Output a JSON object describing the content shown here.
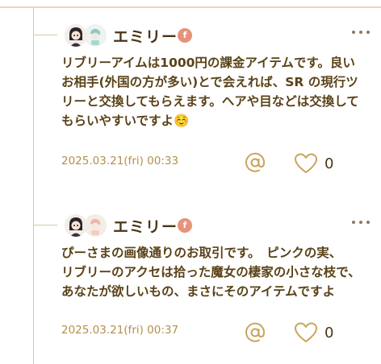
{
  "comments": [
    {
      "username": "エミリー",
      "badge": "f",
      "body": "リブリーアイムは1000円の課金アイテムです。良い\nお相手(外国の方が多い)とで会えれば、SR の現行ツ\nリーと交換してもらえます。ヘアや目などは交換して\nもらいやすいですよ☺️",
      "timestamp": "2025.03.21(fri) 00:33",
      "like_count": "0"
    },
    {
      "username": "エミリー",
      "badge": "f",
      "body": "ぴーさまの画像通りのお取引です。　ピンクの実、\nリブリーのアクセは拾った魔女の棲家の小さな枝で、\nあなたが欲しいもの、まさにそのアイテムですよ",
      "timestamp": "2025.03.21(fri) 00:37",
      "like_count": "0"
    }
  ],
  "icons": {
    "mention": "at-sign-icon",
    "like": "heart-icon",
    "more": "more-horizontal-icon"
  },
  "colors": {
    "text": "#5a4218",
    "timestamp": "#b38f4b",
    "badge": "#e8927a",
    "line": "#d8c8a8"
  }
}
